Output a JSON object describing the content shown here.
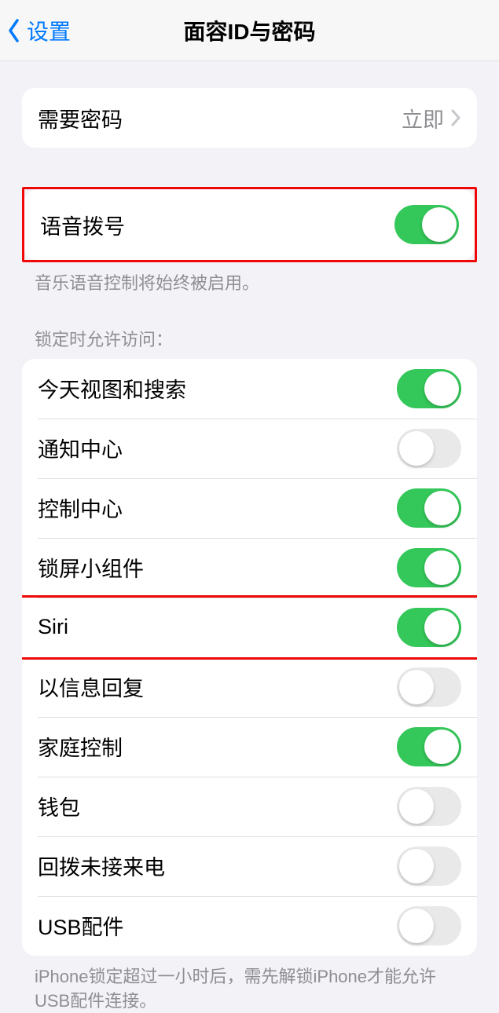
{
  "nav": {
    "back_label": "设置",
    "title": "面容ID与密码"
  },
  "require_passcode": {
    "label": "需要密码",
    "value": "立即"
  },
  "voice_dial": {
    "label": "语音拨号",
    "enabled": true,
    "footer": "音乐语音控制将始终被启用。"
  },
  "lock_access": {
    "header": "锁定时允许访问：",
    "items": [
      {
        "label": "今天视图和搜索",
        "enabled": true
      },
      {
        "label": "通知中心",
        "enabled": false
      },
      {
        "label": "控制中心",
        "enabled": true
      },
      {
        "label": "锁屏小组件",
        "enabled": true
      },
      {
        "label": "Siri",
        "enabled": true,
        "highlighted": true
      },
      {
        "label": "以信息回复",
        "enabled": false
      },
      {
        "label": "家庭控制",
        "enabled": true
      },
      {
        "label": "钱包",
        "enabled": false
      },
      {
        "label": "回拨未接来电",
        "enabled": false
      },
      {
        "label": "USB配件",
        "enabled": false
      }
    ],
    "footer": "iPhone锁定超过一小时后，需先解锁iPhone才能允许USB配件连接。"
  }
}
